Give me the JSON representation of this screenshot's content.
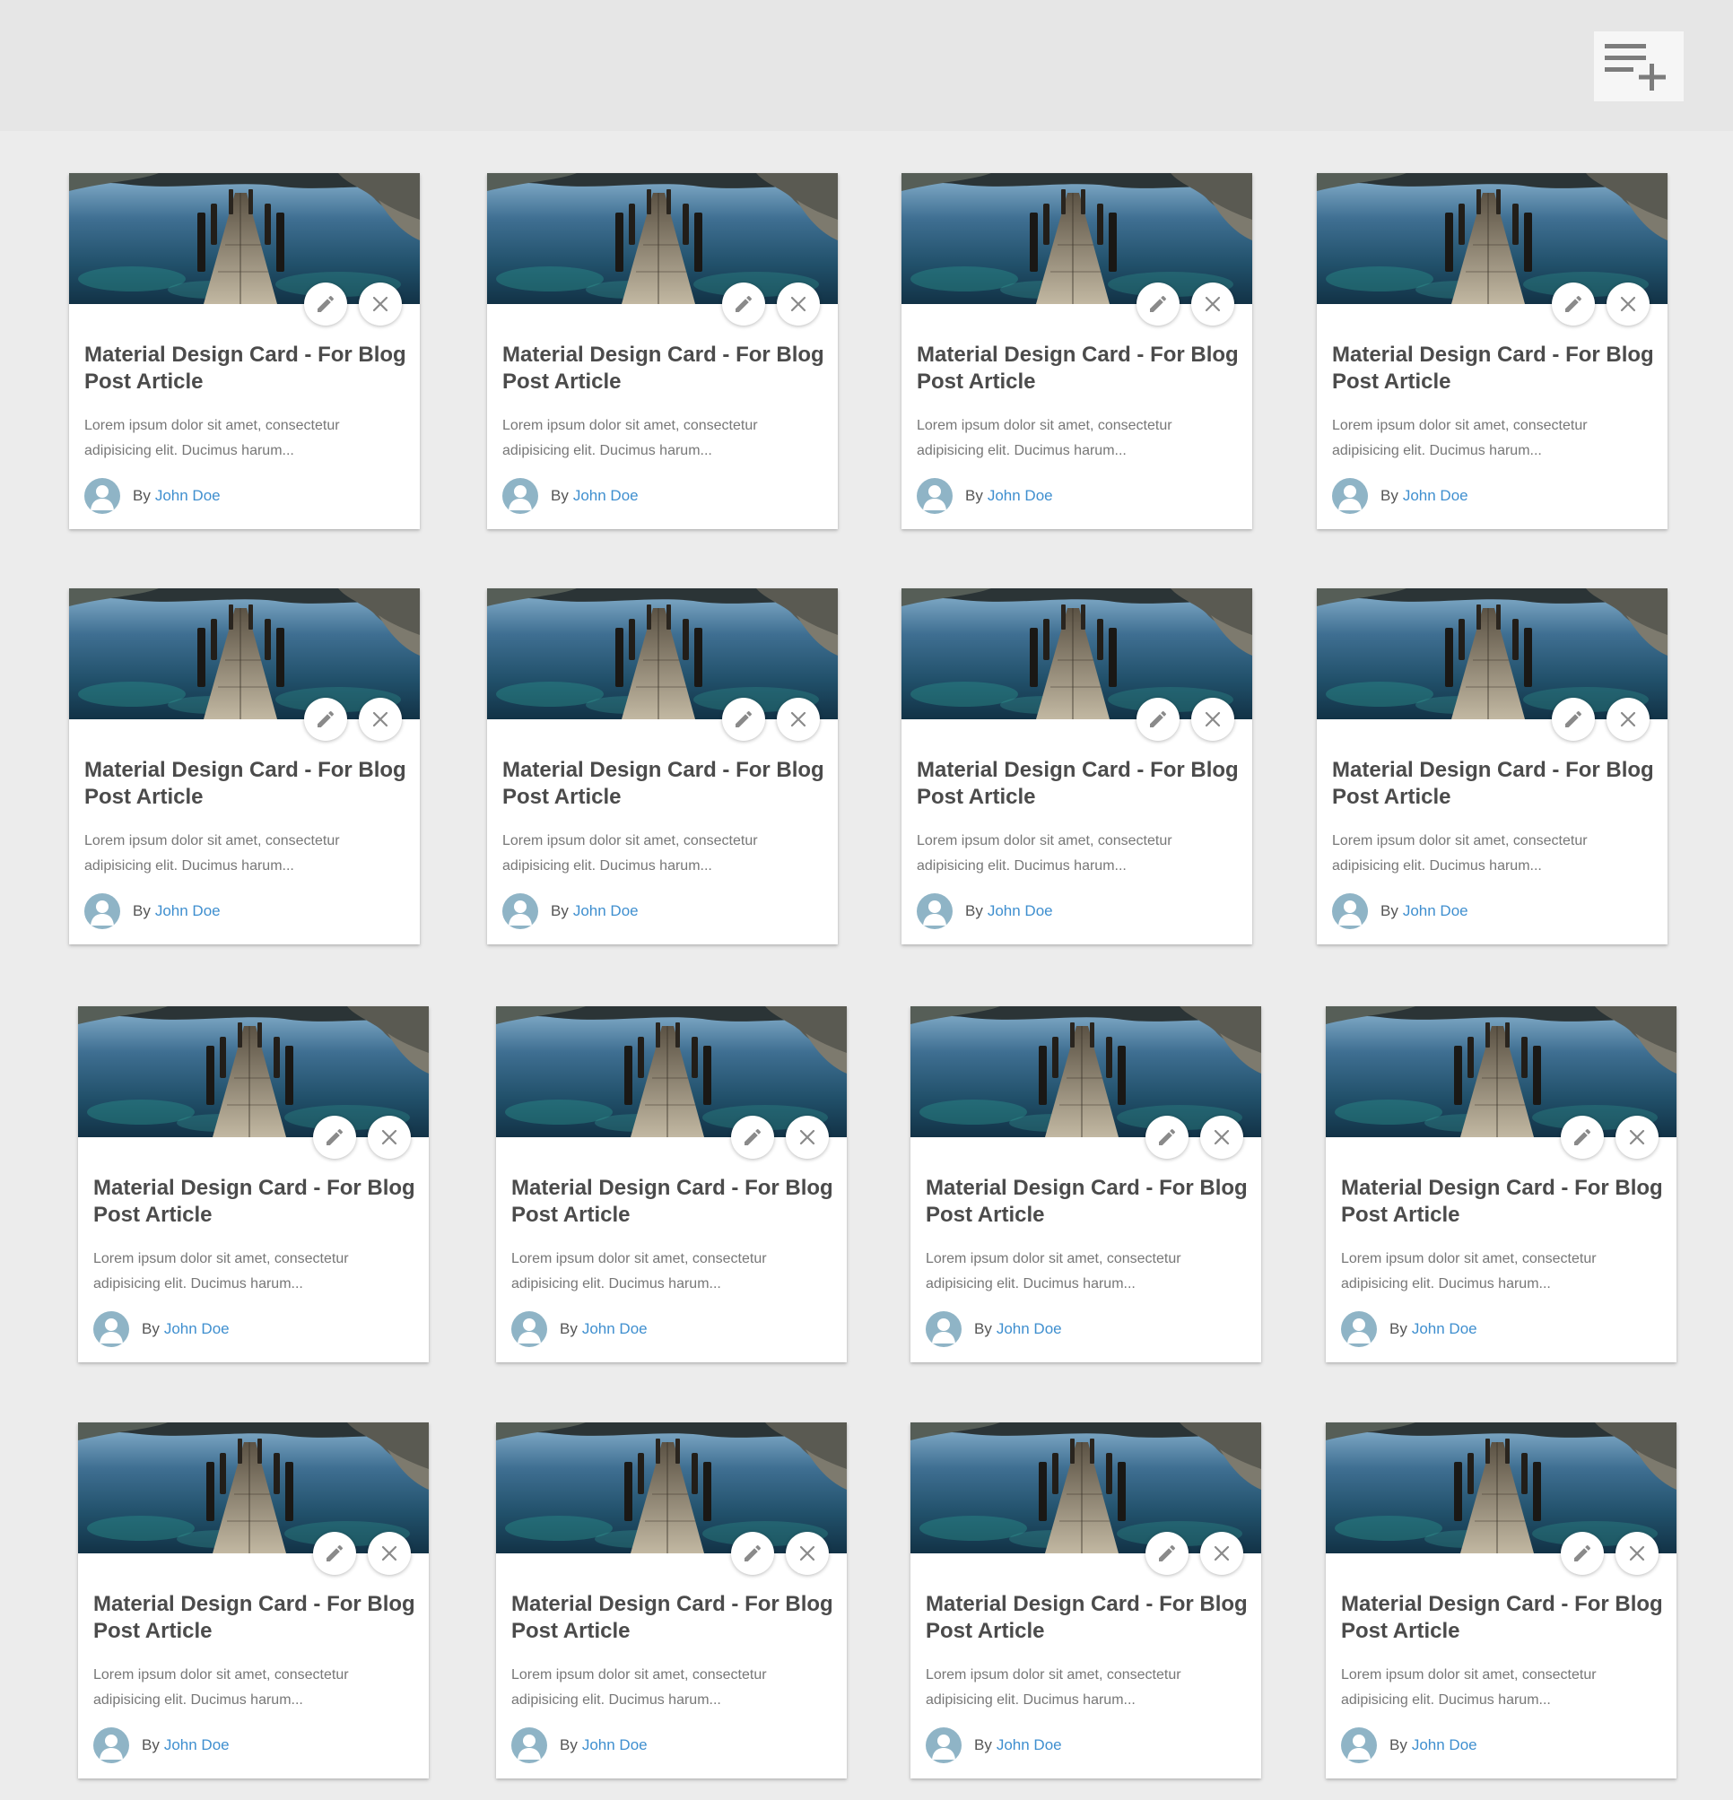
{
  "toolbar": {
    "add_icon": "playlist-add-icon"
  },
  "cards": [
    {
      "title": "Material Design Card - For Blog Post Article",
      "excerpt_line1": "Lorem ipsum dolor sit amet, consectetur",
      "excerpt_line2": "adipisicing elit. Ducimus harum...",
      "by": "By",
      "author": "John Doe"
    },
    {
      "title": "Material Design Card - For Blog Post Article",
      "excerpt_line1": "Lorem ipsum dolor sit amet, consectetur",
      "excerpt_line2": "adipisicing elit. Ducimus harum...",
      "by": "By",
      "author": "John Doe"
    },
    {
      "title": "Material Design Card - For Blog Post Article",
      "excerpt_line1": "Lorem ipsum dolor sit amet, consectetur",
      "excerpt_line2": "adipisicing elit. Ducimus harum...",
      "by": "By",
      "author": "John Doe"
    },
    {
      "title": "Material Design Card - For Blog Post Article",
      "excerpt_line1": "Lorem ipsum dolor sit amet, consectetur",
      "excerpt_line2": "adipisicing elit. Ducimus harum...",
      "by": "By",
      "author": "John Doe"
    },
    {
      "title": "Material Design Card - For Blog Post Article",
      "excerpt_line1": "Lorem ipsum dolor sit amet, consectetur",
      "excerpt_line2": "adipisicing elit. Ducimus harum...",
      "by": "By",
      "author": "John Doe"
    },
    {
      "title": "Material Design Card - For Blog Post Article",
      "excerpt_line1": "Lorem ipsum dolor sit amet, consectetur",
      "excerpt_line2": "adipisicing elit. Ducimus harum...",
      "by": "By",
      "author": "John Doe"
    },
    {
      "title": "Material Design Card - For Blog Post Article",
      "excerpt_line1": "Lorem ipsum dolor sit amet, consectetur",
      "excerpt_line2": "adipisicing elit. Ducimus harum...",
      "by": "By",
      "author": "John Doe"
    },
    {
      "title": "Material Design Card - For Blog Post Article",
      "excerpt_line1": "Lorem ipsum dolor sit amet, consectetur",
      "excerpt_line2": "adipisicing elit. Ducimus harum...",
      "by": "By",
      "author": "John Doe"
    },
    {
      "title": "Material Design Card - For Blog Post Article",
      "excerpt_line1": "Lorem ipsum dolor sit amet, consectetur",
      "excerpt_line2": "adipisicing elit. Ducimus harum...",
      "by": "By",
      "author": "John Doe"
    },
    {
      "title": "Material Design Card - For Blog Post Article",
      "excerpt_line1": "Lorem ipsum dolor sit amet, consectetur",
      "excerpt_line2": "adipisicing elit. Ducimus harum...",
      "by": "By",
      "author": "John Doe"
    },
    {
      "title": "Material Design Card - For Blog Post Article",
      "excerpt_line1": "Lorem ipsum dolor sit amet, consectetur",
      "excerpt_line2": "adipisicing elit. Ducimus harum...",
      "by": "By",
      "author": "John Doe"
    },
    {
      "title": "Material Design Card - For Blog Post Article",
      "excerpt_line1": "Lorem ipsum dolor sit amet, consectetur",
      "excerpt_line2": "adipisicing elit. Ducimus harum...",
      "by": "By",
      "author": "John Doe"
    },
    {
      "title": "Material Design Card - For Blog Post Article",
      "excerpt_line1": "Lorem ipsum dolor sit amet, consectetur",
      "excerpt_line2": "adipisicing elit. Ducimus harum...",
      "by": "By",
      "author": "John Doe"
    },
    {
      "title": "Material Design Card - For Blog Post Article",
      "excerpt_line1": "Lorem ipsum dolor sit amet, consectetur",
      "excerpt_line2": "adipisicing elit. Ducimus harum...",
      "by": "By",
      "author": "John Doe"
    },
    {
      "title": "Material Design Card - For Blog Post Article",
      "excerpt_line1": "Lorem ipsum dolor sit amet, consectetur",
      "excerpt_line2": "adipisicing elit. Ducimus harum...",
      "by": "By",
      "author": "John Doe"
    },
    {
      "title": "Material Design Card - For Blog Post Article",
      "excerpt_line1": "Lorem ipsum dolor sit amet, consectetur",
      "excerpt_line2": "adipisicing elit. Ducimus harum...",
      "by": "By",
      "author": "John Doe"
    }
  ],
  "colors": {
    "page_background": "#ececec",
    "header_background": "#e6e6e6",
    "card_background": "#ffffff",
    "title_text": "#4b4b4b",
    "excerpt_text": "#777777",
    "author_link": "#3f8fcf",
    "avatar": "#8fb4c6"
  },
  "icons": {
    "card_image": "lake-pier-photo",
    "edit": "pencil-icon",
    "delete": "close-icon",
    "author": "user-avatar-icon"
  }
}
